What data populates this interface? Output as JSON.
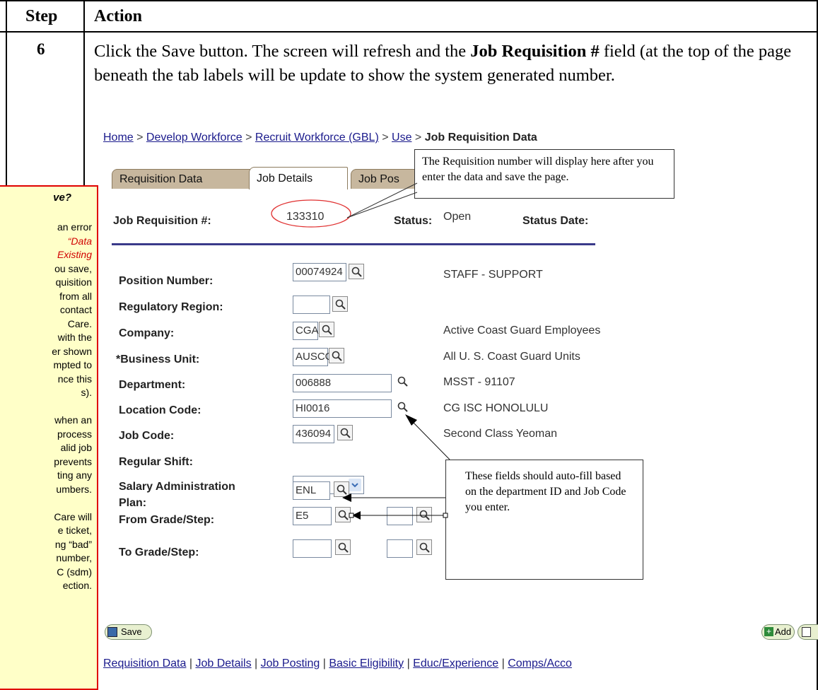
{
  "table": {
    "col_step": "Step",
    "col_action": "Action",
    "step_number": "6"
  },
  "instruction": {
    "part1": "Click the Save button. The screen will refresh and the ",
    "bold1": "Job Requisition #",
    "part2": " field (at the top of the page beneath the tab labels will be update to show the system generated number."
  },
  "sidebar_note": {
    "title": "ve?",
    "lines": [
      {
        "text": "an error",
        "style": "normal"
      },
      {
        "text": "“Data",
        "style": "red"
      },
      {
        "text": "Existing",
        "style": "red"
      },
      {
        "text": "ou save,",
        "style": "normal"
      },
      {
        "text": "quisition",
        "style": "normal"
      },
      {
        "text": "from all",
        "style": "normal"
      },
      {
        "text": "contact",
        "style": "normal"
      },
      {
        "text": "Care.",
        "style": "normal"
      },
      {
        "text": "with the",
        "style": "normal"
      },
      {
        "text": "er shown",
        "style": "normal"
      },
      {
        "text": "mpted to",
        "style": "normal"
      },
      {
        "text": "nce this",
        "style": "normal"
      },
      {
        "text": "s).",
        "style": "normal"
      },
      {
        "text": "",
        "style": "normal"
      },
      {
        "text": "when an",
        "style": "normal"
      },
      {
        "text": "process",
        "style": "normal"
      },
      {
        "text": "alid job",
        "style": "normal"
      },
      {
        "text": "prevents",
        "style": "normal"
      },
      {
        "text": "ting any",
        "style": "normal"
      },
      {
        "text": "umbers.",
        "style": "normal"
      },
      {
        "text": "",
        "style": "normal"
      },
      {
        "text": "Care will",
        "style": "normal"
      },
      {
        "text": "e ticket,",
        "style": "normal"
      },
      {
        "text": "ng “bad”",
        "style": "normal"
      },
      {
        "text": "number,",
        "style": "normal"
      },
      {
        "text": "C (sdm)",
        "style": "normal"
      },
      {
        "text": "ection.",
        "style": "normal"
      }
    ]
  },
  "breadcrumb": {
    "home": "Home",
    "develop": "Develop Workforce",
    "recruit": "Recruit Workforce (GBL)",
    "use": "Use",
    "current": "Job Requisition Data",
    "separator": " > "
  },
  "tabs": {
    "requisition_data": "Requisition Data",
    "job_details": "Job Details",
    "job_posting": "Job Pos"
  },
  "callout_top": "The Requisition number will display here after you enter the data and save the page.",
  "header_row": {
    "job_req_label": "Job Requisition #:",
    "job_req_value": "133310",
    "status_label": "Status:",
    "status_value": "Open",
    "status_date_label": "Status Date:"
  },
  "form": {
    "position_number": {
      "label": "Position Number:",
      "value": "00074924",
      "description": "STAFF - SUPPORT"
    },
    "regulatory_region": {
      "label": "Regulatory Region:",
      "value": ""
    },
    "company": {
      "label": "Company:",
      "value": "CGA",
      "description": "Active Coast Guard Employees"
    },
    "business_unit": {
      "label": "*Business Unit:",
      "value": "AUSCG",
      "description": "All U. S. Coast Guard Units"
    },
    "department": {
      "label": "Department:",
      "value": "006888",
      "description": "MSST - 91107"
    },
    "location_code": {
      "label": "Location Code:",
      "value": "HI0016",
      "description": "CG ISC HONOLULU"
    },
    "job_code": {
      "label": "Job Code:",
      "value": "436094",
      "description": "Second Class Yeoman"
    },
    "regular_shift": {
      "label": "Regular Shift:",
      "value": ""
    },
    "salary_admin_plan": {
      "label_line1": "Salary Administration",
      "label_line2": "Plan:",
      "value": "ENL"
    },
    "from_grade_step": {
      "label": "From Grade/Step:",
      "grade": "E5",
      "step": ""
    },
    "to_grade_step": {
      "label": "To Grade/Step:",
      "grade": "",
      "step": ""
    }
  },
  "callout_bottom": "These fields should auto-fill based on the department ID and Job Code you enter.",
  "buttons": {
    "save": "Save",
    "add": "Add"
  },
  "footer_links": [
    "Requisition Data",
    "Job Details",
    "Job Posting",
    "Basic Eligibility",
    "Educ/Experience",
    "Comps/Acco"
  ],
  "colors": {
    "link": "#1a1a8c",
    "tab_inactive": "#c7b79e",
    "note_bg": "#ffffc8",
    "note_border": "#e00000",
    "annotation_ellipse": "#e03030"
  }
}
